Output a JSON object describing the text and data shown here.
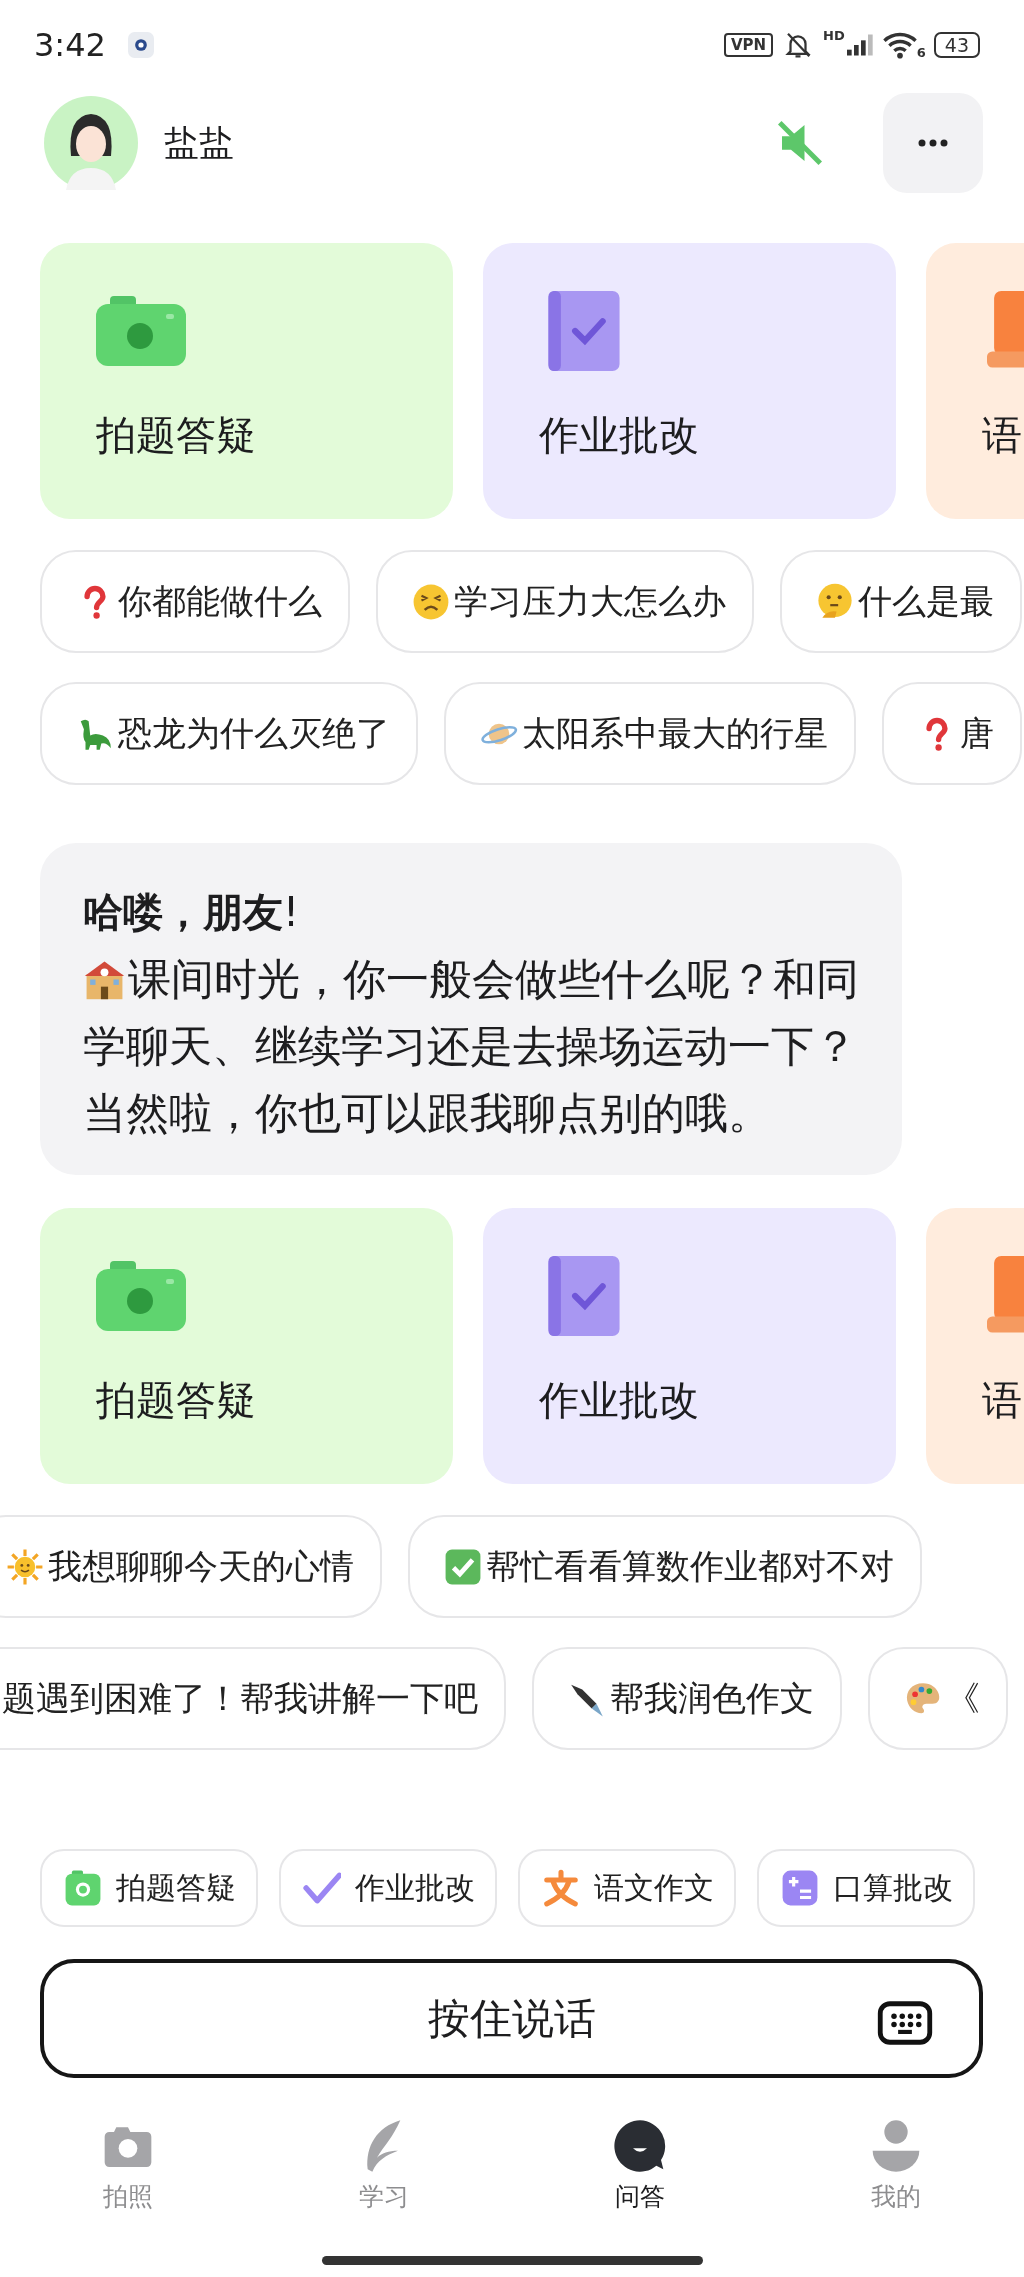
{
  "status_bar": {
    "time": "3:42",
    "vpn": "VPN",
    "network": "HD",
    "wifi_gen": "6",
    "battery": "43"
  },
  "header": {
    "name": "盐盐",
    "sound_off": true
  },
  "feature_cards_top": [
    {
      "kind": "camera",
      "label": "拍题答疑",
      "color": "#e3fbd9"
    },
    {
      "kind": "homework",
      "label": "作业批改",
      "color": "#ece9fe"
    },
    {
      "kind": "essay",
      "label": "语",
      "color": "#ffecdd"
    }
  ],
  "suggestion_rows_top": [
    [
      {
        "kind": "question",
        "label": "你都能做什么"
      },
      {
        "kind": "tired",
        "label": "学习压力大怎么办"
      },
      {
        "kind": "thinking",
        "label": "什么是最"
      }
    ],
    [
      {
        "kind": "dinosaur",
        "label": "恐龙为什么灭绝了"
      },
      {
        "kind": "planet",
        "label": "太阳系中最大的行星"
      },
      {
        "kind": "question",
        "label": "唐"
      }
    ]
  ],
  "message": {
    "title": "**哈喽，朋友**!",
    "lines": [
      "课间时光，你一般会做些什么呢？和同",
      "学聊天、继续学习还是去操场运动一下？当然啦，你也可以跟我聊点别的哦。"
    ]
  },
  "feature_cards_bottom": [
    {
      "kind": "camera",
      "label": "拍题答疑",
      "color": "#e3fbd9"
    },
    {
      "kind": "homework",
      "label": "作业批改",
      "color": "#ece9fe"
    },
    {
      "kind": "essay",
      "label": "语",
      "color": "#ffecdd"
    }
  ],
  "suggestion_rows_bottom": [
    [
      {
        "kind": "sun",
        "label": "我想聊聊今天的心情"
      },
      {
        "kind": "check",
        "label": "帮忙看看算数作业都对不对"
      }
    ],
    [
      {
        "kind": "text",
        "label": "题遇到困难了！帮我讲解一下吧"
      },
      {
        "kind": "pen",
        "label": "帮我润色作文"
      },
      {
        "kind": "palette",
        "label": "《"
      }
    ]
  ],
  "quick_actions": [
    {
      "kind": "camera",
      "label": "拍题答疑"
    },
    {
      "kind": "check",
      "label": "作业批改"
    },
    {
      "kind": "essay",
      "label": "语文作文"
    },
    {
      "kind": "calc",
      "label": "口算批改"
    }
  ],
  "talk_button": {
    "label": "按住说话"
  },
  "tab_bar": [
    {
      "kind": "camera",
      "label": "拍照",
      "selected": false
    },
    {
      "kind": "feather",
      "label": "学习",
      "selected": false
    },
    {
      "kind": "chat",
      "label": "问答",
      "selected": true
    },
    {
      "kind": "person",
      "label": "我的",
      "selected": false
    }
  ]
}
